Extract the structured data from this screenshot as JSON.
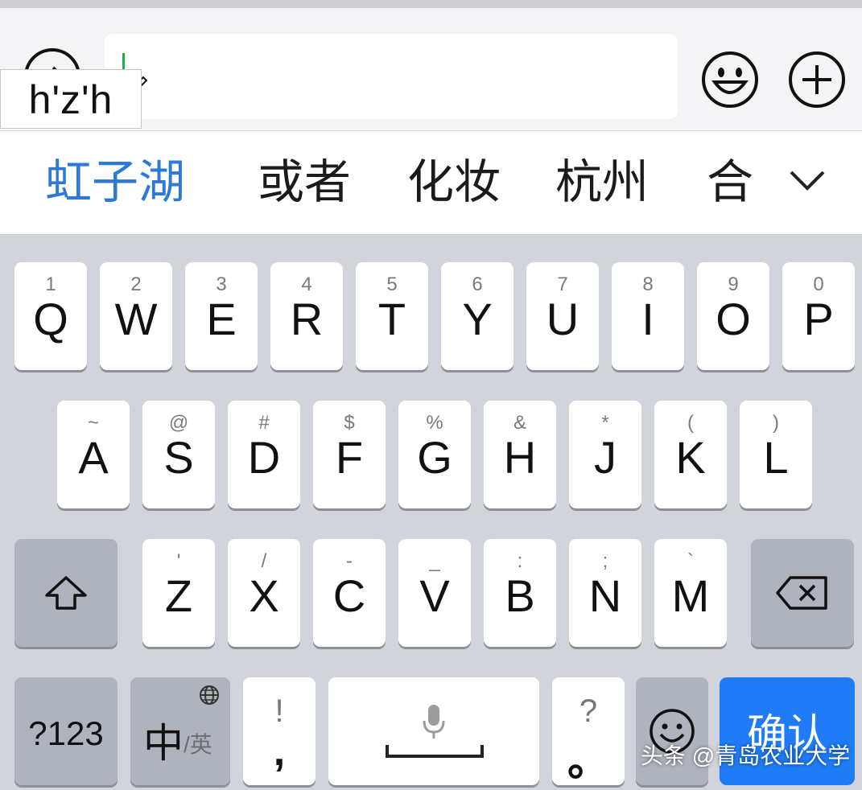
{
  "input": {
    "pinyin": "h'z'h",
    "voice_icon": "voice-wave-icon",
    "emoji_icon": "emoji-face-icon",
    "plus_icon": "add-circle-icon"
  },
  "candidates": {
    "items": [
      "虹子湖",
      "或者",
      "化妆",
      "杭州",
      "合"
    ],
    "selected_index": 0,
    "selected_color": "#2f79d6",
    "expand_icon": "chevron-down-icon"
  },
  "keyboard": {
    "row1": [
      {
        "letter": "Q",
        "hint": "1"
      },
      {
        "letter": "W",
        "hint": "2"
      },
      {
        "letter": "E",
        "hint": "3"
      },
      {
        "letter": "R",
        "hint": "4"
      },
      {
        "letter": "T",
        "hint": "5"
      },
      {
        "letter": "Y",
        "hint": "6"
      },
      {
        "letter": "U",
        "hint": "7"
      },
      {
        "letter": "I",
        "hint": "8"
      },
      {
        "letter": "O",
        "hint": "9"
      },
      {
        "letter": "P",
        "hint": "0"
      }
    ],
    "row2": [
      {
        "letter": "A",
        "hint": "~"
      },
      {
        "letter": "S",
        "hint": "@"
      },
      {
        "letter": "D",
        "hint": "#"
      },
      {
        "letter": "F",
        "hint": "$"
      },
      {
        "letter": "G",
        "hint": "%"
      },
      {
        "letter": "H",
        "hint": "&"
      },
      {
        "letter": "J",
        "hint": "*"
      },
      {
        "letter": "K",
        "hint": "("
      },
      {
        "letter": "L",
        "hint": ")"
      }
    ],
    "row3": [
      {
        "letter": "Z",
        "hint": "'"
      },
      {
        "letter": "X",
        "hint": "/"
      },
      {
        "letter": "C",
        "hint": "-"
      },
      {
        "letter": "V",
        "hint": "_"
      },
      {
        "letter": "B",
        "hint": ":"
      },
      {
        "letter": "N",
        "hint": ";"
      },
      {
        "letter": "M",
        "hint": "`"
      }
    ],
    "shift_icon": "shift-arrow-icon",
    "delete_icon": "backspace-icon",
    "numbers_label": "?123",
    "lang_main": "中",
    "lang_sub": "/英",
    "globe_icon": "globe-icon",
    "punct_top_left": "!",
    "punct_bottom_left": ",",
    "mic_icon": "microphone-icon",
    "punct_top_right": "?",
    "punct_bottom_right": "。",
    "emoji_icon": "emoji-face-icon",
    "confirm_label": "确认",
    "key_color": "#ffffff",
    "function_key_color": "#aeb3bd",
    "confirm_color": "#1f7cf6"
  },
  "watermark": "头条 @青岛农业大学"
}
